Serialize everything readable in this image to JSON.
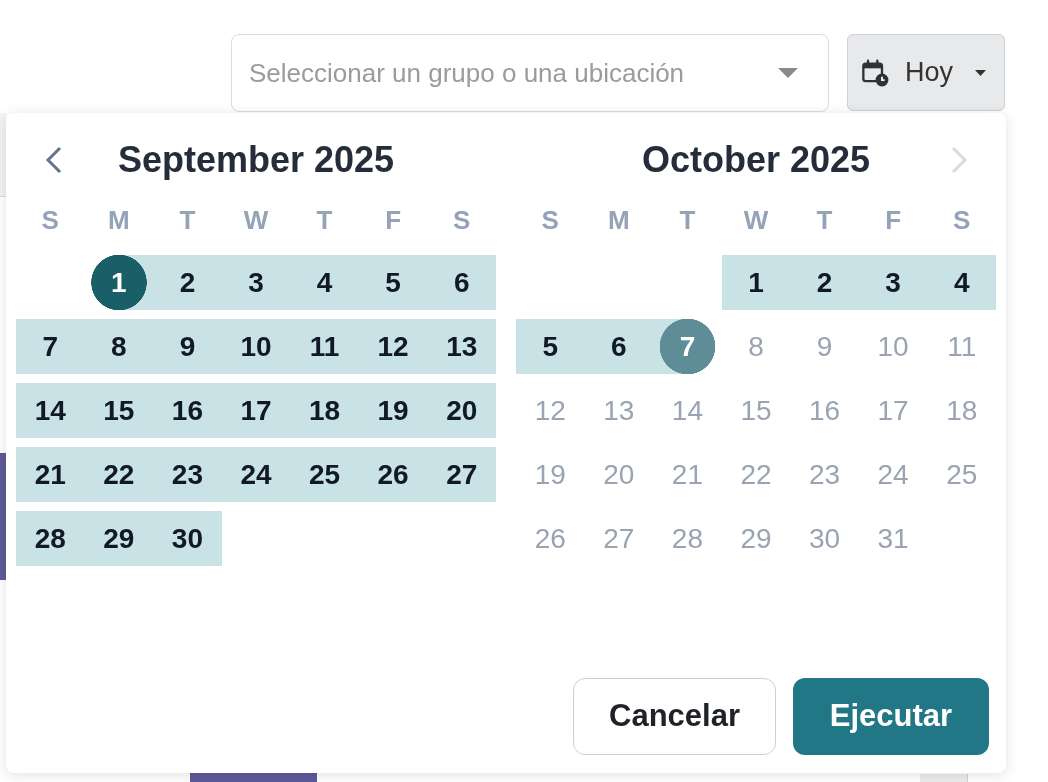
{
  "toolbar": {
    "location_select": {
      "placeholder": "Seleccionar un grupo o una ubicación"
    },
    "date_button": {
      "label": "Hoy"
    }
  },
  "date_picker": {
    "months": [
      {
        "title": "September 2025",
        "nav": {
          "kind": "prev",
          "disabled": false
        },
        "weekdays": [
          "S",
          "M",
          "T",
          "W",
          "T",
          "F",
          "S"
        ],
        "weeks": [
          [
            {
              "label": "1",
              "selected": true,
              "in_range": true,
              "disabled": false
            },
            {
              "label": "2",
              "selected": false,
              "in_range": true,
              "disabled": false
            },
            {
              "label": "3",
              "selected": false,
              "in_range": true,
              "disabled": false
            },
            {
              "label": "4",
              "selected": false,
              "in_range": true,
              "disabled": false
            },
            {
              "label": "5",
              "selected": false,
              "in_range": true,
              "disabled": false
            },
            {
              "label": "6",
              "selected": false,
              "in_range": true,
              "disabled": false
            }
          ],
          [
            {
              "label": "7",
              "selected": false,
              "in_range": true,
              "disabled": false
            },
            {
              "label": "8",
              "selected": false,
              "in_range": true,
              "disabled": false
            },
            {
              "label": "9",
              "selected": false,
              "in_range": true,
              "disabled": false
            },
            {
              "label": "10",
              "selected": false,
              "in_range": true,
              "disabled": false
            },
            {
              "label": "11",
              "selected": false,
              "in_range": true,
              "disabled": false
            },
            {
              "label": "12",
              "selected": false,
              "in_range": true,
              "disabled": false
            },
            {
              "label": "13",
              "selected": false,
              "in_range": true,
              "disabled": false
            }
          ],
          [
            {
              "label": "14",
              "selected": false,
              "in_range": true,
              "disabled": false
            },
            {
              "label": "15",
              "selected": false,
              "in_range": true,
              "disabled": false
            },
            {
              "label": "16",
              "selected": false,
              "in_range": true,
              "disabled": false
            },
            {
              "label": "17",
              "selected": false,
              "in_range": true,
              "disabled": false
            },
            {
              "label": "18",
              "selected": false,
              "in_range": true,
              "disabled": false
            },
            {
              "label": "19",
              "selected": false,
              "in_range": true,
              "disabled": false
            },
            {
              "label": "20",
              "selected": false,
              "in_range": true,
              "disabled": false
            }
          ],
          [
            {
              "label": "21",
              "selected": false,
              "in_range": true,
              "disabled": false
            },
            {
              "label": "22",
              "selected": false,
              "in_range": true,
              "disabled": false
            },
            {
              "label": "23",
              "selected": false,
              "in_range": true,
              "disabled": false
            },
            {
              "label": "24",
              "selected": false,
              "in_range": true,
              "disabled": false
            },
            {
              "label": "25",
              "selected": false,
              "in_range": true,
              "disabled": false
            },
            {
              "label": "26",
              "selected": false,
              "in_range": true,
              "disabled": false
            },
            {
              "label": "27",
              "selected": false,
              "in_range": true,
              "disabled": false
            }
          ],
          [
            {
              "label": "28",
              "selected": false,
              "in_range": true,
              "disabled": false
            },
            {
              "label": "29",
              "selected": false,
              "in_range": true,
              "disabled": false
            },
            {
              "label": "30",
              "selected": false,
              "in_range": true,
              "disabled": false
            }
          ]
        ]
      },
      {
        "title": "October 2025",
        "nav": {
          "kind": "next",
          "disabled": true
        },
        "weekdays": [
          "S",
          "M",
          "T",
          "W",
          "T",
          "F",
          "S"
        ],
        "weeks": [
          [
            {
              "label": "1",
              "selected": false,
              "in_range": true,
              "disabled": false
            },
            {
              "label": "2",
              "selected": false,
              "in_range": true,
              "disabled": false
            },
            {
              "label": "3",
              "selected": false,
              "in_range": true,
              "disabled": false
            },
            {
              "label": "4",
              "selected": false,
              "in_range": true,
              "disabled": false
            }
          ],
          [
            {
              "label": "5",
              "selected": false,
              "in_range": true,
              "disabled": false
            },
            {
              "label": "6",
              "selected": false,
              "in_range": true,
              "disabled": false
            },
            {
              "label": "7",
              "selected": true,
              "in_range": true,
              "disabled": false
            },
            {
              "label": "8",
              "selected": false,
              "in_range": false,
              "disabled": true
            },
            {
              "label": "9",
              "selected": false,
              "in_range": false,
              "disabled": true
            },
            {
              "label": "10",
              "selected": false,
              "in_range": false,
              "disabled": true
            },
            {
              "label": "11",
              "selected": false,
              "in_range": false,
              "disabled": true
            }
          ],
          [
            {
              "label": "12",
              "selected": false,
              "in_range": false,
              "disabled": true
            },
            {
              "label": "13",
              "selected": false,
              "in_range": false,
              "disabled": true
            },
            {
              "label": "14",
              "selected": false,
              "in_range": false,
              "disabled": true
            },
            {
              "label": "15",
              "selected": false,
              "in_range": false,
              "disabled": true
            },
            {
              "label": "16",
              "selected": false,
              "in_range": false,
              "disabled": true
            },
            {
              "label": "17",
              "selected": false,
              "in_range": false,
              "disabled": true
            },
            {
              "label": "18",
              "selected": false,
              "in_range": false,
              "disabled": true
            }
          ],
          [
            {
              "label": "19",
              "selected": false,
              "in_range": false,
              "disabled": true
            },
            {
              "label": "20",
              "selected": false,
              "in_range": false,
              "disabled": true
            },
            {
              "label": "21",
              "selected": false,
              "in_range": false,
              "disabled": true
            },
            {
              "label": "22",
              "selected": false,
              "in_range": false,
              "disabled": true
            },
            {
              "label": "23",
              "selected": false,
              "in_range": false,
              "disabled": true
            },
            {
              "label": "24",
              "selected": false,
              "in_range": false,
              "disabled": true
            },
            {
              "label": "25",
              "selected": false,
              "in_range": false,
              "disabled": true
            }
          ],
          [
            {
              "label": "26",
              "selected": false,
              "in_range": false,
              "disabled": true
            },
            {
              "label": "27",
              "selected": false,
              "in_range": false,
              "disabled": true
            },
            {
              "label": "28",
              "selected": false,
              "in_range": false,
              "disabled": true
            },
            {
              "label": "29",
              "selected": false,
              "in_range": false,
              "disabled": true
            },
            {
              "label": "30",
              "selected": false,
              "in_range": false,
              "disabled": true
            },
            {
              "label": "31",
              "selected": false,
              "in_range": false,
              "disabled": true
            }
          ]
        ]
      }
    ],
    "buttons": [
      {
        "label": "Cancelar",
        "kind": "secondary"
      },
      {
        "label": "Ejecutar",
        "kind": "primary"
      }
    ]
  }
}
